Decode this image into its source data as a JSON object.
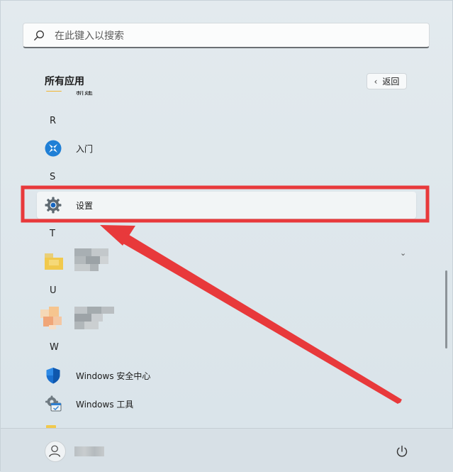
{
  "search": {
    "placeholder": "在此键入以搜索",
    "icon": "search-icon"
  },
  "all_apps": {
    "title": "所有应用",
    "back_label": "返回"
  },
  "app_list": {
    "partial_top_label": "新建",
    "sections": [
      {
        "letter": "R",
        "apps": [
          {
            "label": "入门",
            "icon": "get-started-icon"
          }
        ]
      },
      {
        "letter": "S",
        "apps": [
          {
            "label": "设置",
            "icon": "settings-gear-icon"
          }
        ]
      },
      {
        "letter": "T",
        "apps": [
          {
            "label": "",
            "icon": "folder-icon"
          }
        ]
      },
      {
        "letter": "U",
        "apps": [
          {
            "label": "",
            "icon": "app-icon"
          }
        ]
      },
      {
        "letter": "W",
        "apps": [
          {
            "label": "Windows 安全中心",
            "icon": "shield-icon"
          },
          {
            "label": "Windows 工具",
            "icon": "windows-tools-icon"
          }
        ]
      }
    ]
  },
  "footer": {
    "avatar_icon": "user-icon",
    "power_icon": "power-icon"
  },
  "annotation": {
    "color": "#e8393b"
  }
}
